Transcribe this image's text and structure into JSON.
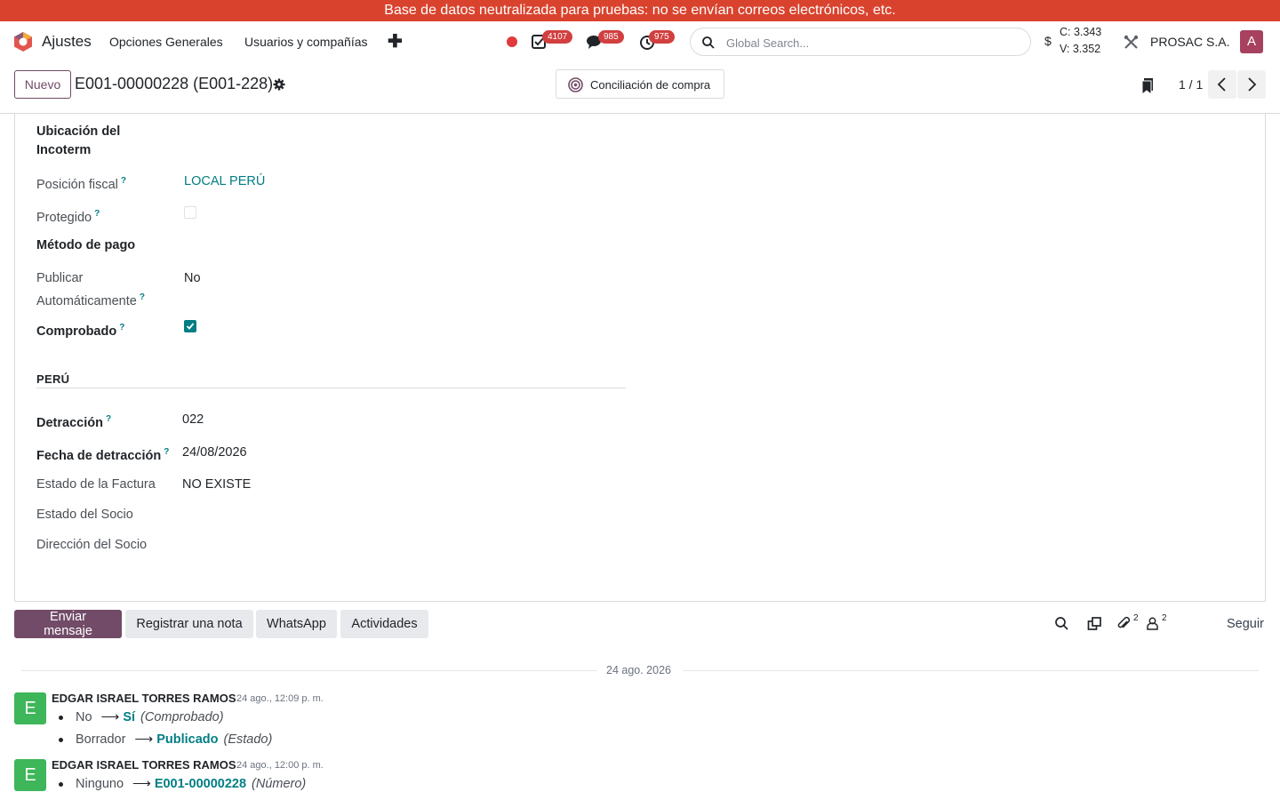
{
  "banner": "Base de datos neutralizada para pruebas: no se envían correos electrónicos, etc.",
  "navbar": {
    "app_name": "Ajustes",
    "menu": [
      "Opciones Generales",
      "Usuarios y compañías"
    ],
    "badges": {
      "activities": "4107",
      "messages": "985",
      "timers": "975"
    },
    "search_placeholder": "Global Search...",
    "currency_symbol": "$",
    "rate_buy": "C: 3.343",
    "rate_sell": "V: 3.352",
    "company": "PROSAC S.A.",
    "avatar_letter": "A"
  },
  "control": {
    "new_label": "Nuevo",
    "record_title": "E001-00000228 (E001-228)",
    "smart_button": "Conciliación de compra",
    "pager": "1 / 1"
  },
  "form": {
    "incoterm_location_label": "Ubicación del Incoterm",
    "fiscal_position_label": "Posición fiscal",
    "fiscal_position_value": "LOCAL PERÚ",
    "protected_label": "Protegido",
    "payment_method_label": "Método de pago",
    "autopost_label_1": "Publicar",
    "autopost_label_2": "Automáticamente",
    "autopost_value": "No",
    "checked_label": "Comprobado",
    "help_mark": "?",
    "section_title": "PERÚ",
    "detraction_label": "Detracción",
    "detraction_value": "022",
    "detraction_date_label": "Fecha de detracción",
    "detraction_date_value": "24/08/2026",
    "invoice_state_label": "Estado de la Factura",
    "invoice_state_value": "NO EXISTE",
    "partner_state_label": "Estado del Socio",
    "partner_address_label": "Dirección del Socio"
  },
  "chatter": {
    "send_message": "Enviar mensaje",
    "log_note": "Registrar una nota",
    "whatsapp": "WhatsApp",
    "activities": "Actividades",
    "attachments_count": "2",
    "followers_count": "2",
    "follow": "Seguir",
    "date_separator": "24 ago. 2026",
    "messages": [
      {
        "avatar": "E",
        "author": "EDGAR ISRAEL TORRES RAMOS",
        "date": "24 ago., 12:09 p. m.",
        "changes": [
          {
            "old": "No",
            "new": "Sí",
            "field": "(Comprobado)"
          },
          {
            "old": "Borrador",
            "new": "Publicado",
            "field": "(Estado)"
          }
        ]
      },
      {
        "avatar": "E",
        "author": "EDGAR ISRAEL TORRES RAMOS",
        "date": "24 ago., 12:00 p. m.",
        "changes": [
          {
            "old": "Ninguno",
            "new": "E001-00000228",
            "field": "(Número)"
          }
        ]
      }
    ]
  }
}
